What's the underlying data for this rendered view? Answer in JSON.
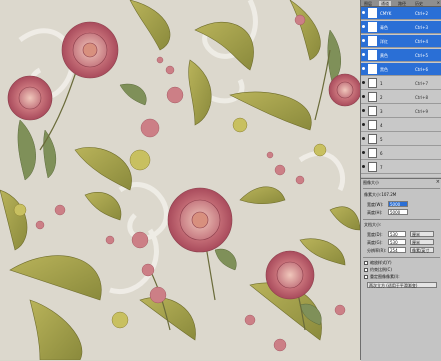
{
  "panel": {
    "tabs": [
      {
        "label": "图层"
      },
      {
        "label": "通道"
      },
      {
        "label": "路径"
      },
      {
        "label": "历史"
      }
    ],
    "close_glyph": "×"
  },
  "layers": [
    {
      "name": "CMYK",
      "shortcut": "Ctrl+2",
      "selected": true
    },
    {
      "name": "青色",
      "shortcut": "Ctrl+3",
      "selected": true
    },
    {
      "name": "洋红",
      "shortcut": "Ctrl+4",
      "selected": true
    },
    {
      "name": "黄色",
      "shortcut": "Ctrl+5",
      "selected": true
    },
    {
      "name": "黑色",
      "shortcut": "Ctrl+6",
      "selected": true
    },
    {
      "name": "1",
      "shortcut": "Ctrl+7",
      "selected": false
    },
    {
      "name": "2",
      "shortcut": "Ctrl+8",
      "selected": false
    },
    {
      "name": "3",
      "shortcut": "Ctrl+9",
      "selected": false
    },
    {
      "name": "4",
      "shortcut": "",
      "selected": false
    },
    {
      "name": "5",
      "shortcut": "",
      "selected": false
    },
    {
      "name": "6",
      "shortcut": "",
      "selected": false
    },
    {
      "name": "7",
      "shortcut": "",
      "selected": false
    }
  ],
  "image_size": {
    "title": "图像大小",
    "close_glyph": "×",
    "pixel_dims_label": "像素大小:107.2M",
    "width_label": "宽度(W):",
    "width_value": "5000",
    "height_label": "高度(H):",
    "height_value": "5000",
    "doc_size_label": "文档大小:",
    "doc_width_label": "宽度(D):",
    "doc_width_value": "530",
    "doc_width_unit": "厘米",
    "doc_height_label": "高度(G):",
    "doc_height_value": "530",
    "doc_height_unit": "厘米",
    "resolution_label": "分辨率(R):",
    "resolution_value": "254",
    "resolution_unit": "像素/英寸",
    "scale_styles_label": "缩放样式(Y)",
    "constrain_label": "约束比例(C)",
    "resample_label": "重定图像像素(I):",
    "resample_value": "两次立方 (适用于平滑渐变)"
  }
}
